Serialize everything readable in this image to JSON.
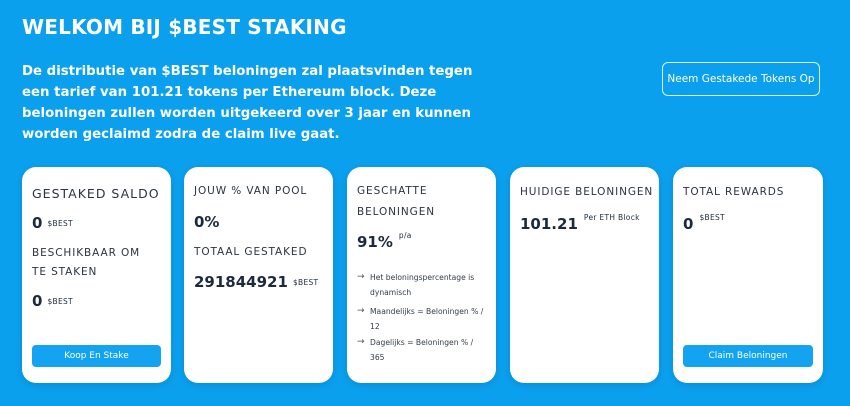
{
  "header": {
    "title": "WELKOM BIJ $BEST STAKING",
    "intro": "De distributie van $BEST beloningen zal plaatsvinden tegen een tarief van 101.21 tokens per Ethereum block. Deze beloningen zullen worden uitgekeerd over 3 jaar en kunnen worden geclaimd zodra de claim live gaat.",
    "withdraw_button": "Neem Gestakede Tokens Op"
  },
  "cards": {
    "staked": {
      "label": "GESTAKED SALDO",
      "value": "0",
      "unit": "$BEST",
      "available_label": "BESCHIKBAAR OM TE STAKEN",
      "available_value": "0",
      "available_unit": "$BEST",
      "button": "Koop En Stake"
    },
    "pool": {
      "label": "JOUW % VAN POOL",
      "value": "0%",
      "total_label": "TOTAAL GESTAKED",
      "total_value": "291844921",
      "total_unit": "$BEST"
    },
    "estimated": {
      "label": "GESCHATTE BELONINGEN",
      "value": "91%",
      "suffix": "p/a",
      "notes": [
        "Het beloningspercentage is dynamisch",
        "Maandelijks = Beloningen % / 12",
        "Dagelijks = Beloningen % / 365"
      ]
    },
    "current": {
      "label": "HUIDIGE BELONINGEN",
      "value": "101.21",
      "suffix": "Per ETH Block"
    },
    "total": {
      "label": "TOTAL REWARDS",
      "value": "0",
      "unit": "$BEST",
      "button": "Claim Beloningen"
    }
  },
  "colors": {
    "background": "#0ba0ee",
    "button": "#14a3f0",
    "card": "#ffffff"
  },
  "icons": {
    "note_arrow": "arrow-right-icon"
  }
}
